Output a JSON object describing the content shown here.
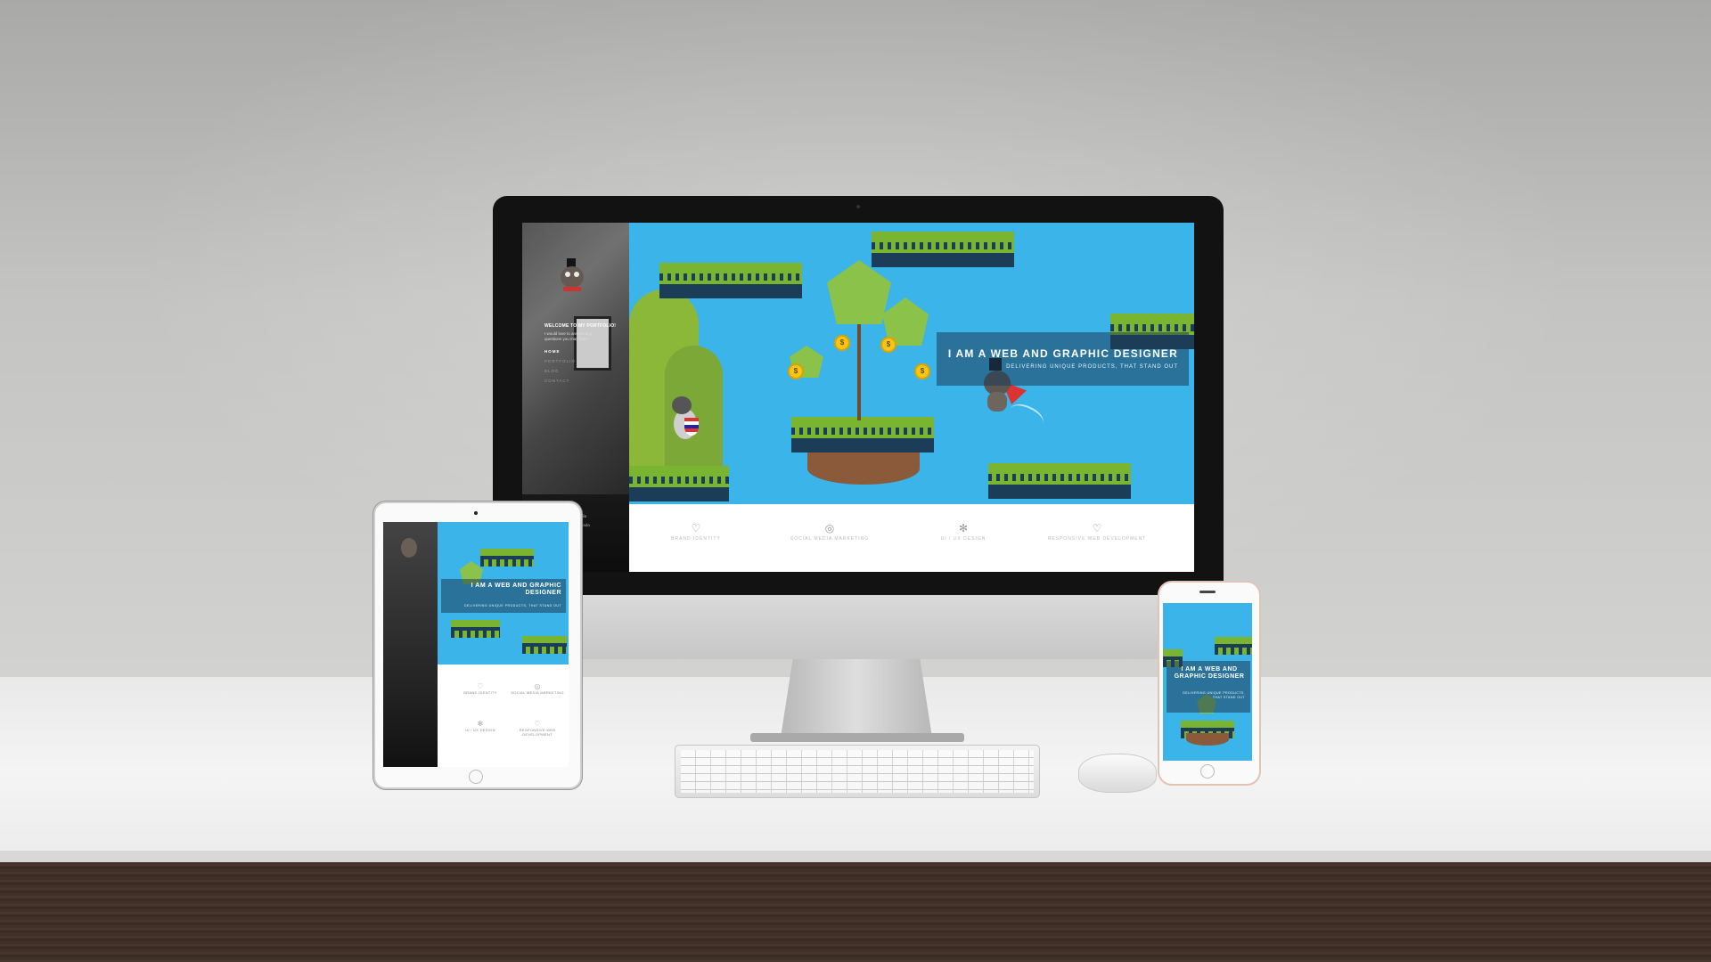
{
  "site": {
    "hero_title": "I AM A WEB AND GRAPHIC DESIGNER",
    "hero_subtitle": "DELIVERING UNIQUE PRODUCTS, THAT STAND OUT",
    "welcome_title": "WELCOME TO MY PORTFOLIO!",
    "welcome_text": "I would love to answer any questions you may have!",
    "nav": [
      "HOME",
      "PORTFOLIO",
      "BLOG",
      "CONTACT"
    ],
    "footer": [
      "Media",
      "Canada"
    ],
    "coin_symbol": "$",
    "services": [
      {
        "icon": "lightbulb-icon",
        "glyph": "♡",
        "label": "BRAND IDENTITY"
      },
      {
        "icon": "target-icon",
        "glyph": "◎",
        "label": "SOCIAL MEDIA MARKETING"
      },
      {
        "icon": "gear-icon",
        "glyph": "✻",
        "label": "UI / UX DESIGN"
      },
      {
        "icon": "heart-icon",
        "glyph": "♡",
        "label": "RESPONSIVE WEB DEVELOPMENT"
      }
    ]
  },
  "tablet": {
    "hero_title": "I AM A WEB AND GRAPHIC DESIGNER",
    "hero_subtitle": "DELIVERING UNIQUE PRODUCTS, THAT STAND OUT",
    "services": [
      "BRAND IDENTITY",
      "SOCIAL MEDIA MARKETING",
      "UI / UX DESIGN",
      "RESPONSIVE WEB DEVELOPMENT"
    ]
  },
  "phone": {
    "hero_title": "I AM A WEB AND GRAPHIC DESIGNER",
    "hero_subtitle": "DELIVERING UNIQUE PRODUCTS, THAT STAND OUT"
  },
  "colors": {
    "sky": "#3ab4e9",
    "grass": "#7ab532",
    "soil": "#1c3d58",
    "banner": "rgba(30,60,90,.55)"
  }
}
